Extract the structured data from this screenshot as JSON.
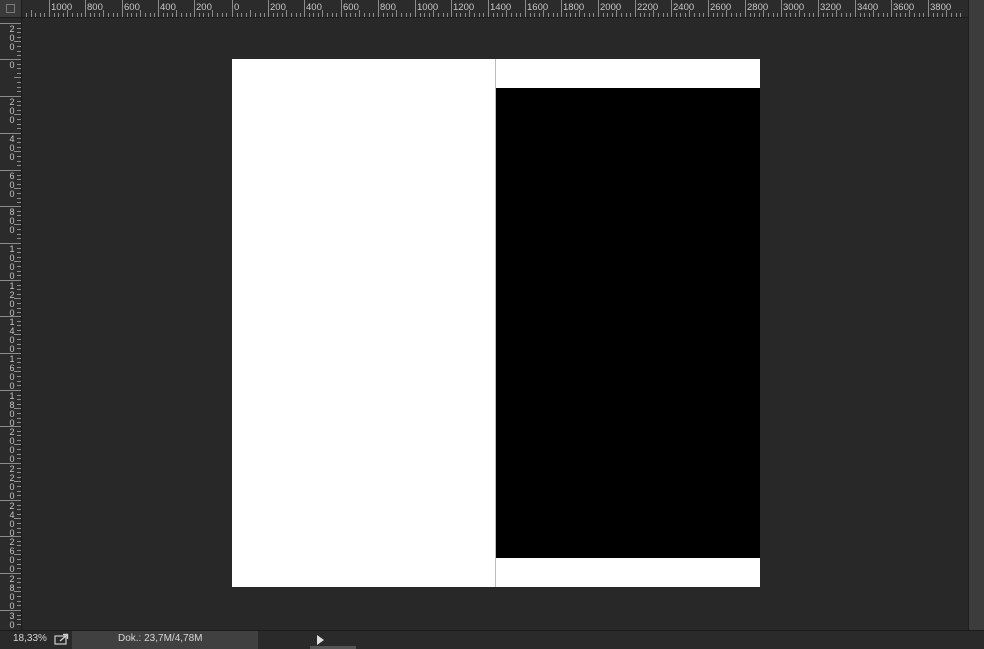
{
  "rulers": {
    "horizontal_labels": [
      "1000",
      "800",
      "600",
      "400",
      "200",
      "0",
      "200",
      "400",
      "600",
      "800",
      "1000",
      "1200",
      "1400",
      "1600",
      "1800",
      "2000",
      "2200",
      "2400",
      "2600",
      "2800",
      "3000",
      "3200",
      "3400",
      "3600",
      "3800"
    ],
    "vertical_labels": [
      "200",
      "0",
      "200",
      "400",
      "600",
      "800",
      "1000",
      "1200",
      "1400",
      "1600",
      "1800",
      "2000",
      "2200",
      "2400",
      "2600",
      "2800",
      "30"
    ]
  },
  "document": {
    "background_color": "#ffffff",
    "shape_color": "#000000"
  },
  "statusbar": {
    "zoom": "18,33%",
    "doc_info": "Dok.: 23,7M/4,78M",
    "share_icon": "share-icon",
    "menu_arrow_icon": "play-arrow-icon"
  }
}
